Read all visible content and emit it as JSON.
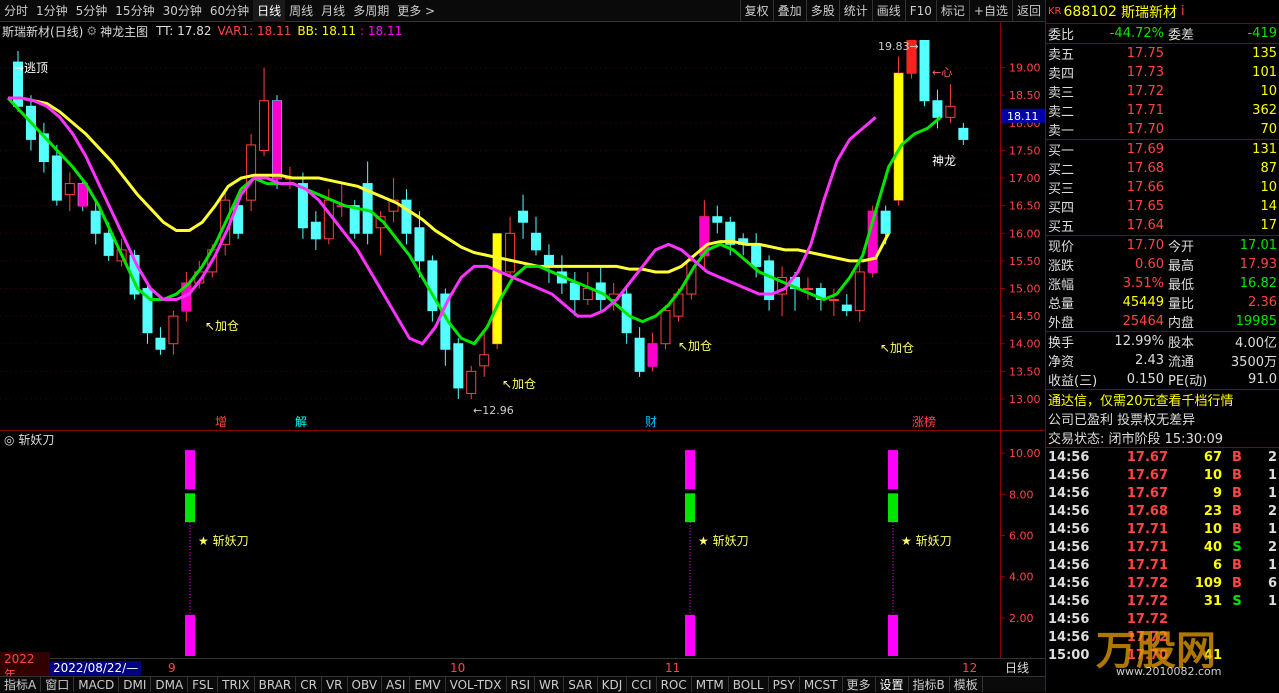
{
  "toolbar": {
    "periods": [
      "分时",
      "1分钟",
      "5分钟",
      "15分钟",
      "30分钟",
      "60分钟",
      "日线",
      "周线",
      "月线",
      "多周期",
      "更多 >"
    ],
    "active": "日线",
    "right": [
      "复权",
      "叠加",
      "多股",
      "统计",
      "画线",
      "F10",
      "标记",
      "+自选",
      "返回"
    ]
  },
  "indicator_header": {
    "name": "斯瑞新材(日线)",
    "indicator": "神龙主图",
    "tt": "TT: 17.82",
    "var1": "VAR1: 18.11",
    "bb": "BB: 18.11",
    "extra": ": 18.11"
  },
  "annotations": {
    "top_escape": "逃顶",
    "add_position": "↖加仓",
    "high_label": "19.83",
    "low_label": "←12.96",
    "heart": "←心",
    "shenlong": "神龙",
    "price_tag": "18.11"
  },
  "event_labels": [
    {
      "text": "增",
      "color": "#ff4444"
    },
    {
      "text": "解",
      "color": "#00ffff"
    },
    {
      "text": "财",
      "color": "#00bfff"
    },
    {
      "text": "涨榜",
      "color": "#ff4444"
    }
  ],
  "sub_header": "斩妖刀",
  "sub_signal": "斩妖刀",
  "main_axis_ticks": [
    "19.00",
    "18.50",
    "18.00",
    "17.50",
    "17.00",
    "16.50",
    "16.00",
    "15.50",
    "15.00",
    "14.50",
    "14.00",
    "13.50",
    "13.00"
  ],
  "sub_axis_ticks": [
    "10.00",
    "8.00",
    "6.00",
    "4.00",
    "2.00"
  ],
  "datebar": {
    "year": "2022年",
    "date": "2022/08/22/—",
    "months": [
      "9",
      "10",
      "11",
      "12"
    ],
    "period": "日线"
  },
  "bottom_tabs": [
    "指标A",
    "窗口",
    "MACD",
    "DMI",
    "DMA",
    "FSL",
    "TRIX",
    "BRAR",
    "CR",
    "VR",
    "OBV",
    "ASI",
    "EMV",
    "VOL-TDX",
    "RSI",
    "WR",
    "SAR",
    "KDJ",
    "CCI",
    "ROC",
    "MTM",
    "BOLL",
    "PSY",
    "MCST",
    "更多",
    "设置",
    "指标B",
    "模板"
  ],
  "stock": {
    "code": "688102",
    "name": "斯瑞新材",
    "market": "KR"
  },
  "weibi": {
    "label": "委比",
    "value": "-44.72%",
    "label2": "委差",
    "value2": "-419"
  },
  "asks": [
    {
      "label": "卖五",
      "price": "17.75",
      "vol": "135"
    },
    {
      "label": "卖四",
      "price": "17.73",
      "vol": "101"
    },
    {
      "label": "卖三",
      "price": "17.72",
      "vol": "10"
    },
    {
      "label": "卖二",
      "price": "17.71",
      "vol": "362"
    },
    {
      "label": "卖一",
      "price": "17.70",
      "vol": "70"
    }
  ],
  "bids": [
    {
      "label": "买一",
      "price": "17.69",
      "vol": "131"
    },
    {
      "label": "买二",
      "price": "17.68",
      "vol": "87"
    },
    {
      "label": "买三",
      "price": "17.66",
      "vol": "10"
    },
    {
      "label": "买四",
      "price": "17.65",
      "vol": "14"
    },
    {
      "label": "买五",
      "price": "17.64",
      "vol": "17"
    }
  ],
  "quote": [
    {
      "l1": "现价",
      "v1": "17.70",
      "c1": "red",
      "l2": "今开",
      "v2": "17.01",
      "c2": "green"
    },
    {
      "l1": "涨跌",
      "v1": "0.60",
      "c1": "red",
      "l2": "最高",
      "v2": "17.93",
      "c2": "red"
    },
    {
      "l1": "涨幅",
      "v1": "3.51%",
      "c1": "red",
      "l2": "最低",
      "v2": "16.82",
      "c2": "green"
    },
    {
      "l1": "总量",
      "v1": "45449",
      "c1": "yellow",
      "l2": "量比",
      "v2": "2.36",
      "c2": "red"
    },
    {
      "l1": "外盘",
      "v1": "25464",
      "c1": "red",
      "l2": "内盘",
      "v2": "19985",
      "c2": "green"
    }
  ],
  "finance": [
    {
      "l1": "换手",
      "v1": "12.99%",
      "l2": "股本",
      "v2": "4.00亿"
    },
    {
      "l1": "净资",
      "v1": "2.43",
      "l2": "流通",
      "v2": "3500万"
    },
    {
      "l1": "收益(三)",
      "v1": "0.150",
      "l2": "PE(动)",
      "v2": "91.0"
    }
  ],
  "notices": [
    "通达信，仅需20元查看千档行情",
    "公司已盈利 投票权无差异",
    "交易状态: 闭市阶段 15:30:09"
  ],
  "ticks": [
    {
      "t": "14:56",
      "p": "17.67",
      "v": "67",
      "d": "B",
      "n": "2"
    },
    {
      "t": "14:56",
      "p": "17.67",
      "v": "10",
      "d": "B",
      "n": "1"
    },
    {
      "t": "14:56",
      "p": "17.67",
      "v": "9",
      "d": "B",
      "n": "1"
    },
    {
      "t": "14:56",
      "p": "17.68",
      "v": "23",
      "d": "B",
      "n": "2"
    },
    {
      "t": "14:56",
      "p": "17.71",
      "v": "10",
      "d": "B",
      "n": "1"
    },
    {
      "t": "14:56",
      "p": "17.71",
      "v": "40",
      "d": "S",
      "n": "2"
    },
    {
      "t": "14:56",
      "p": "17.71",
      "v": "6",
      "d": "B",
      "n": "1"
    },
    {
      "t": "14:56",
      "p": "17.72",
      "v": "109",
      "d": "B",
      "n": "6"
    },
    {
      "t": "14:56",
      "p": "17.72",
      "v": "31",
      "d": "S",
      "n": "1"
    },
    {
      "t": "14:56",
      "p": "17.72",
      "v": "",
      "d": "",
      "n": ""
    },
    {
      "t": "14:56",
      "p": "17.72",
      "v": "",
      "d": "",
      "n": ""
    },
    {
      "t": "15:00",
      "p": "17.70",
      "v": "41",
      "d": "",
      "n": ""
    }
  ],
  "watermark": "万股网",
  "watermark_url": "www.2010082.com"
}
